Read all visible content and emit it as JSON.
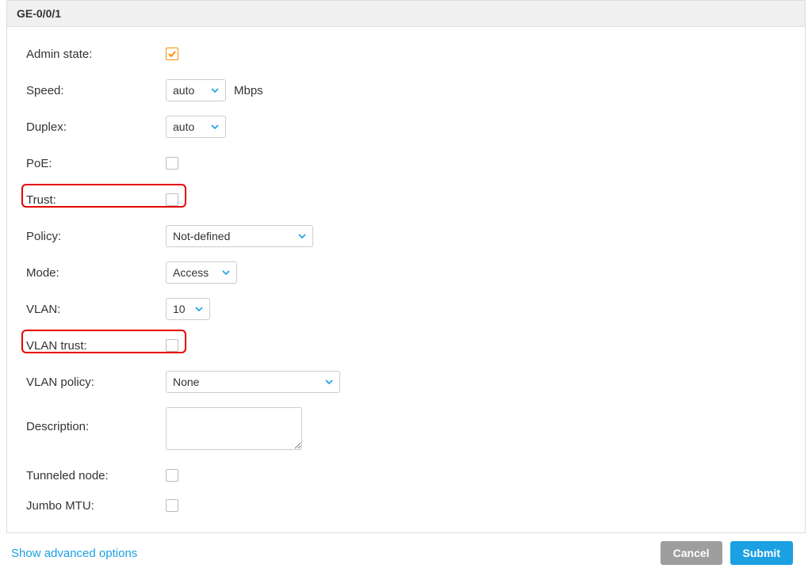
{
  "header": {
    "title": "GE-0/0/1"
  },
  "form": {
    "admin_state_label": "Admin state:",
    "admin_state_checked": true,
    "speed_label": "Speed:",
    "speed_value": "auto",
    "speed_unit": "Mbps",
    "duplex_label": "Duplex:",
    "duplex_value": "auto",
    "poe_label": "PoE:",
    "poe_checked": false,
    "trust_label": "Trust:",
    "trust_checked": false,
    "policy_label": "Policy:",
    "policy_value": "Not-defined",
    "mode_label": "Mode:",
    "mode_value": "Access",
    "vlan_label": "VLAN:",
    "vlan_value": "10",
    "vlan_trust_label": "VLAN trust:",
    "vlan_trust_checked": false,
    "vlan_policy_label": "VLAN policy:",
    "vlan_policy_value": "None",
    "description_label": "Description:",
    "description_value": "",
    "tunneled_label": "Tunneled node:",
    "tunneled_checked": false,
    "jumbo_label": "Jumbo MTU:",
    "jumbo_checked": false
  },
  "footer": {
    "adv_link": "Show advanced options",
    "cancel": "Cancel",
    "submit": "Submit"
  }
}
